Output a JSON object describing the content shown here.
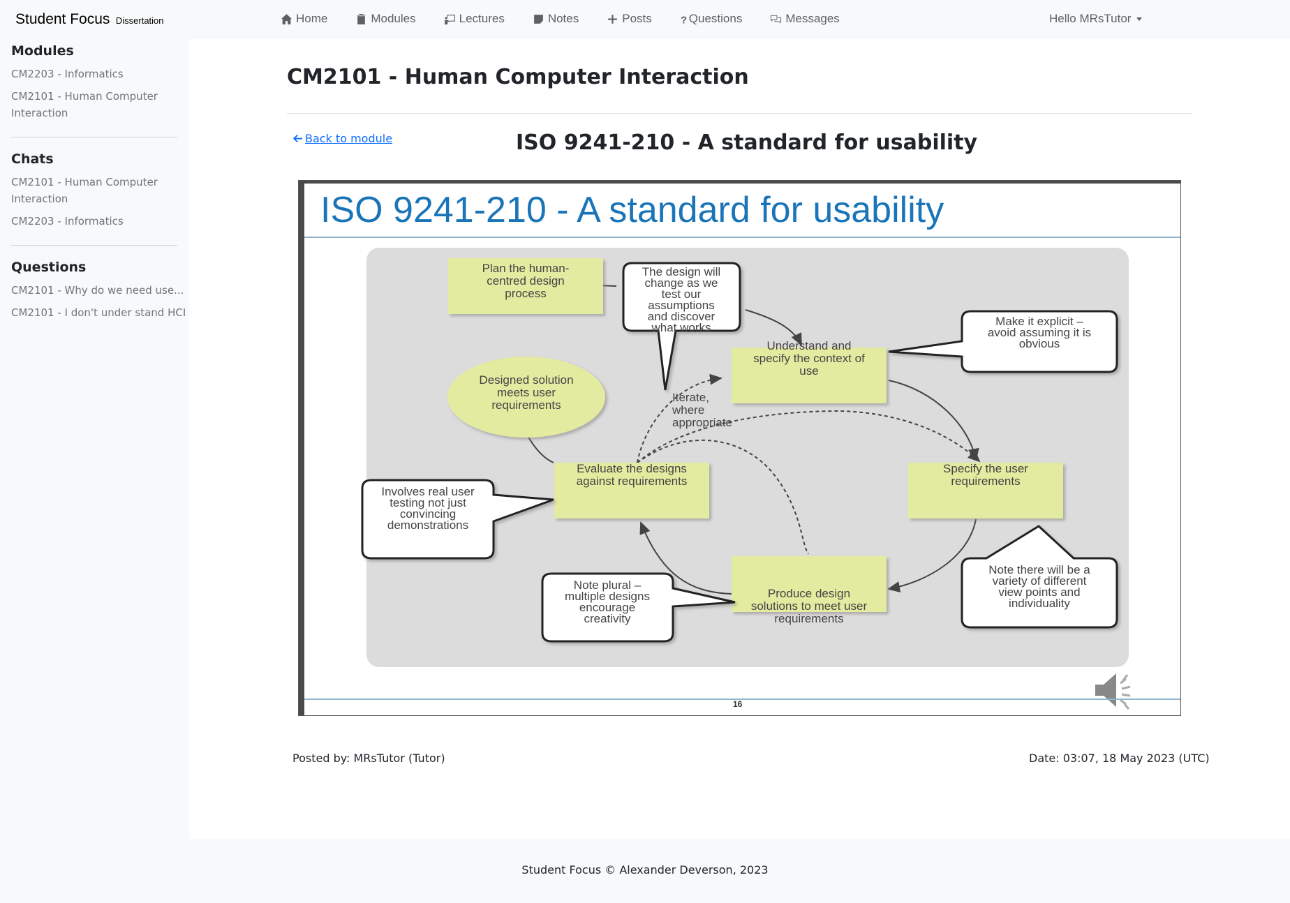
{
  "brand": {
    "name": "Student Focus",
    "sub": "Dissertation"
  },
  "nav": {
    "items": [
      {
        "label": "Home",
        "icon": "house-icon"
      },
      {
        "label": "Modules",
        "icon": "clipboard-icon"
      },
      {
        "label": "Lectures",
        "icon": "presentation-icon"
      },
      {
        "label": "Notes",
        "icon": "note-icon"
      },
      {
        "label": "Posts",
        "icon": "plus-icon"
      },
      {
        "label": "Questions",
        "icon": "question-icon"
      },
      {
        "label": "Messages",
        "icon": "chat-icon"
      }
    ],
    "user_greeting": "Hello MRsTutor"
  },
  "sidebar": {
    "modules": {
      "heading": "Modules",
      "items": [
        "CM2203 - Informatics",
        "CM2101 - Human Computer Interaction"
      ]
    },
    "chats": {
      "heading": "Chats",
      "items": [
        "CM2101 - Human Computer Interaction",
        "CM2203 - Informatics"
      ]
    },
    "questions": {
      "heading": "Questions",
      "items": [
        "CM2101 - Why do we need use...",
        "CM2101 - I don't under stand HCI"
      ]
    }
  },
  "main": {
    "module_title": "CM2101 - Human Computer Interaction",
    "back_link": "Back to module",
    "lecture_title": "ISO 9241-210 - A standard for usability",
    "posted_by": "Posted by: MRsTutor (Tutor)",
    "date": "Date: 03:07, 18 May 2023 (UTC)"
  },
  "slide": {
    "title": "ISO 9241-210 - A standard for usability",
    "page_number": "16",
    "boxes": {
      "plan": [
        "Plan the human-",
        "centred design",
        "process"
      ],
      "understand": [
        "Understand and",
        "specify the context of",
        "use"
      ],
      "specify": [
        "Specify the user",
        "requirements"
      ],
      "produce": [
        "Produce design",
        "solutions to meet user",
        "requirements"
      ],
      "evaluate": [
        "Evaluate the designs",
        "against requirements"
      ],
      "designed": [
        "Designed solution",
        "meets user",
        "requirements"
      ],
      "iterate": [
        "Iterate,",
        "where",
        "appropriate"
      ]
    },
    "callouts": {
      "design_change": [
        "The design will",
        "change as we",
        "test our",
        "assumptions",
        "and discover",
        "what works"
      ],
      "explicit": [
        "Make it explicit –",
        "avoid assuming it is",
        "obvious"
      ],
      "real_user": [
        "Involves real user",
        "testing not just",
        "convincing",
        "demonstrations"
      ],
      "plural": [
        "Note plural –",
        "multiple designs",
        "encourage",
        "creativity"
      ],
      "viewpoints": [
        "Note there will be a",
        "variety of different",
        "view points and",
        "individuality"
      ]
    },
    "colors": {
      "box_fill": "#e3eba0",
      "panel_fill": "#dcdcdc",
      "title_blue": "#1a75b8"
    }
  },
  "footer": {
    "text": "Student Focus © Alexander Deverson, 2023"
  }
}
